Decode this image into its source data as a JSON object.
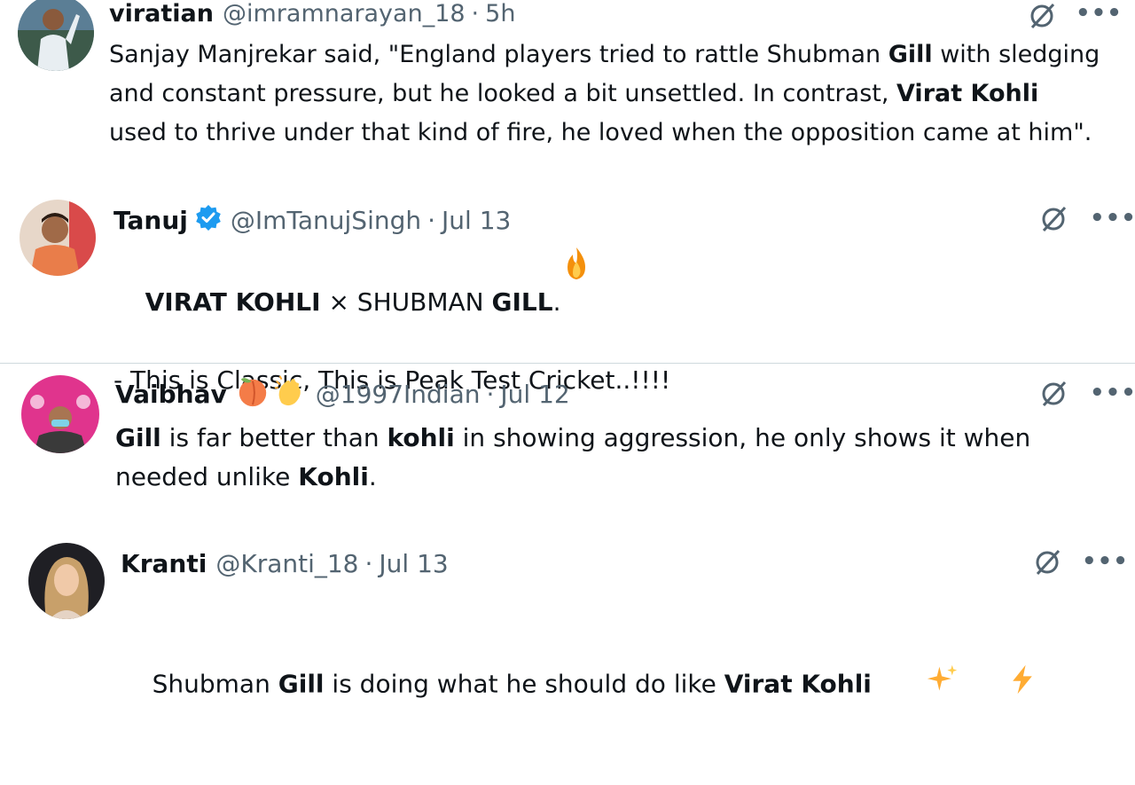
{
  "tweets": [
    {
      "name": "viratian",
      "handle": "@imramnarayan_18",
      "dot": "·",
      "time": "5h",
      "body": [
        {
          "t": "Sanjay Manjrekar said, \"England players tried to rattle Shubman ",
          "b": false
        },
        {
          "t": "Gill",
          "b": true
        },
        {
          "t": " with sledging and constant pressure, but he looked a bit unsettled. In contrast, ",
          "b": false
        },
        {
          "t": "Virat Kohli",
          "b": true
        },
        {
          "t": " used to thrive under that kind of fire, he loved when the opposition came at him\".",
          "b": false
        }
      ]
    },
    {
      "name": "Tanuj",
      "handle": "@ImTanujSingh",
      "dot": "·",
      "time": "Jul 13",
      "verified": true,
      "body": [
        {
          "t": "VIRAT KOHLI",
          "b": true
        },
        {
          "t": " × SHUBMAN ",
          "b": false
        },
        {
          "t": "GILL",
          "b": true
        },
        {
          "t": ". ",
          "b": false
        },
        {
          "t": "\n\n- This is Classic, This is Peak Test Cricket..!!!!",
          "b": false
        }
      ],
      "emoji": "fire-emoji"
    },
    {
      "name": "Vaibhav",
      "handle": "@1997Indian",
      "dot": "·",
      "time": "Jul 12",
      "name_emojis": [
        "peach-emoji",
        "clapping-hands-emoji"
      ],
      "body": [
        {
          "t": "Gill",
          "b": true
        },
        {
          "t": " is far better than ",
          "b": false
        },
        {
          "t": "kohli",
          "b": true
        },
        {
          "t": " in showing aggression, he only shows it when needed unlike ",
          "b": false
        },
        {
          "t": "Kohli",
          "b": true
        },
        {
          "t": ".",
          "b": false
        }
      ]
    },
    {
      "name": "Kranti",
      "handle": "@Kranti_18",
      "dot": "·",
      "time": "Jul 13",
      "body": [
        {
          "t": "Shubman ",
          "b": false
        },
        {
          "t": "Gill",
          "b": true
        },
        {
          "t": " is doing what he should do like ",
          "b": false
        },
        {
          "t": "Virat Kohli",
          "b": true
        },
        {
          "t": " ",
          "b": false
        }
      ],
      "emojis": [
        "sparkles-emoji",
        "lightning-emoji"
      ]
    }
  ],
  "icons": {
    "grok": "grok-icon",
    "more": "more-options-icon",
    "more_glyph": "•••",
    "verified": "verified-badge-icon"
  },
  "colors": {
    "verified": "#1d9bf0",
    "secondary_text": "#536471",
    "divider": "#cfd9de"
  }
}
